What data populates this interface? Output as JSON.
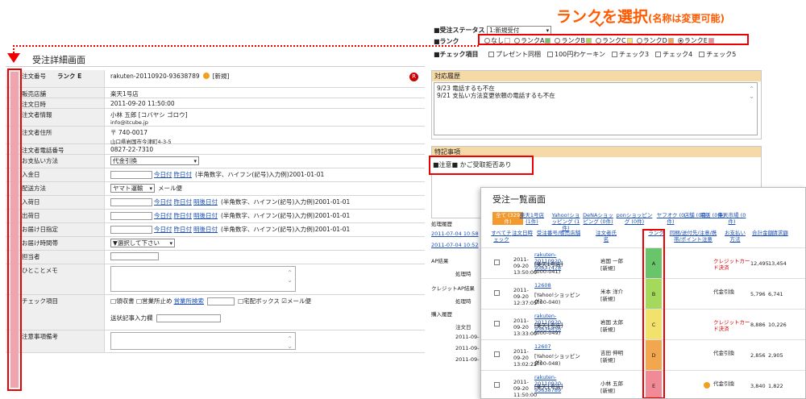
{
  "callout": {
    "title": "ランクを選択",
    "note": "(名称は変更可能)"
  },
  "controls": {
    "status_label": "■受注ステータス",
    "status_value": "1:新規受付",
    "rank_label": "■ランク",
    "rank_options": [
      {
        "label": "なし",
        "color": "#ffffff",
        "selected": false
      },
      {
        "label": "ランクA",
        "color": "#6ac46a",
        "selected": false
      },
      {
        "label": "ランクB",
        "color": "#a5d95c",
        "selected": false
      },
      {
        "label": "ランクC",
        "color": "#f2e16b",
        "selected": false
      },
      {
        "label": "ランクD",
        "color": "#f2a64e",
        "selected": false
      },
      {
        "label": "ランクE",
        "color": "#ef8a96",
        "selected": true
      }
    ],
    "check_label": "■チェック項目",
    "check_items": [
      "プレゼント同梱",
      "100円わケーキン",
      "チェック3",
      "チェック4",
      "チェック5"
    ]
  },
  "detail": {
    "title": "受注詳細画面",
    "rows": [
      {
        "label": "注文番号",
        "extra": "ランク E",
        "value": "rakuten-20110920-93638789",
        "badge": "[新規]"
      },
      {
        "label": "販売店舗",
        "value": "楽天1号店"
      },
      {
        "label": "注文日時",
        "value": "2011-09-20 11:50:00"
      },
      {
        "label": "注文者情報",
        "value": "小林 五郎 [コバヤシ ゴロウ]",
        "value2": "info@itcube.jp"
      },
      {
        "label": "注文者住所",
        "value": "〒 740-0017",
        "value2": "山口県岩国市今津町4-3-5"
      },
      {
        "label": "注文者電話番号",
        "value": "0827-22-7310"
      },
      {
        "label": "お支払い方法",
        "value": "代金引換"
      },
      {
        "label": "入金日",
        "value": "(半角数字、ハイフン(記号)入力例)2001-01-01"
      },
      {
        "label": "配送方法",
        "value": "ヤマト運輸",
        "value2": "メール便"
      },
      {
        "label": "入荷日",
        "value": "(半角数字、ハイフン(記号)入力例)2001-01-01"
      },
      {
        "label": "出荷日",
        "value": "(半角数字、ハイフン(記号)入力例)2001-01-01"
      },
      {
        "label": "お届け日指定",
        "value": "(半角数字、ハイフン(記号)入力例)2001-01-01"
      },
      {
        "label": "お届け時間帯",
        "value": "▼選択して下さい"
      },
      {
        "label": "担当者",
        "value": ""
      },
      {
        "label": "ひとことメモ",
        "value": ""
      },
      {
        "label": "チェック項目",
        "value": "□領収書 □営業所止め",
        "link": "営業所検索",
        "value2": "□宅配ボックス ☑メール便",
        "value3": "送状記事入力欄"
      },
      {
        "label": "注意事項備考",
        "value": ""
      }
    ],
    "date_links": [
      "今日付",
      "昨日付",
      "明後日付"
    ]
  },
  "right": {
    "history_head": "対応履歴",
    "history_lines": [
      "9/23 電話するも不在",
      "9/21 支払い方法変更依頼の電話するも不在"
    ],
    "notes_head": "特記事項",
    "notes_value": "■注意■ かご受取拒否あり",
    "side_labels": [
      "処理履歴",
      "2011-07-04 10:58",
      "2011-07-04 10:52",
      "AP結果",
      "処理時",
      "クレジットAP結果",
      "処理時",
      "購入履歴",
      "注文日",
      "2011-09-",
      "2011-09-",
      "2011-09-"
    ]
  },
  "list": {
    "title": "受注一覧画面",
    "tabs": [
      "全て (329件)",
      "楽天1号店 (1件)",
      "Yahoo!ショッピング (1件)",
      "DeNAショッピング (0件)",
      "ponショッピング (0件)",
      "ヤフオク (0件)",
      "店舗 (0件)",
      "電話 (0件)",
      "楽天市場 (0件)"
    ],
    "headers": [
      "すべてチェック",
      "注文日時",
      "受注番号/販売店舗",
      "注文者氏名",
      "ランク",
      "同梱/送付先/注意/携帯/ポイント注意",
      "お支払い方法",
      "合計金額",
      "請求額"
    ],
    "rows": [
      {
        "date": "2011-09-20 13:50:00",
        "order": "rakuten-20110920-93637478",
        "shop": "[楽天1号店]",
        "code": "(000-041)",
        "name": "岩国 一郎",
        "badge": "[新規]",
        "rank": "A",
        "rank_color": "#6ac46a",
        "pay": "クレジットカード決済",
        "total": "12,495",
        "bill": "13,454"
      },
      {
        "date": "2011-09-20 12:37:05",
        "order": "12608",
        "shop": "[Yahoo!ショッピング]",
        "code": "(000-040)",
        "name": "米本 洋介",
        "badge": "[新規]",
        "rank": "B",
        "rank_color": "#a5d95c",
        "pay": "代金引換",
        "total": "5,796",
        "bill": "6,741"
      },
      {
        "date": "2011-09-20 13:33:00",
        "order": "rakuten-20110920-93636856",
        "shop": "[楽天1号店]",
        "code": "(000-049)",
        "name": "岩国 太郎",
        "badge": "[新規]",
        "rank": "C",
        "rank_color": "#f2e16b",
        "pay": "クレジットカード決済",
        "total": "8,886",
        "bill": "10,226"
      },
      {
        "date": "2011-09-20 13:02:22",
        "order": "12607",
        "shop": "[Yahoo!ショッピング]",
        "code": "(000-048)",
        "name": "吉田 伸明",
        "badge": "[新規]",
        "rank": "D",
        "rank_color": "#f2a64e",
        "pay": "代金引換",
        "total": "2,856",
        "bill": "2,905"
      },
      {
        "date": "2011-09-20 11:50:00",
        "order": "rakuten-20110920-93638789",
        "shop": "[楽天1号店]",
        "code": "",
        "name": "小林 五郎",
        "badge": "[新規]",
        "rank": "E",
        "rank_color": "#ef8a96",
        "pay": "代金引換",
        "total": "3,840",
        "bill": "1,822"
      }
    ]
  }
}
